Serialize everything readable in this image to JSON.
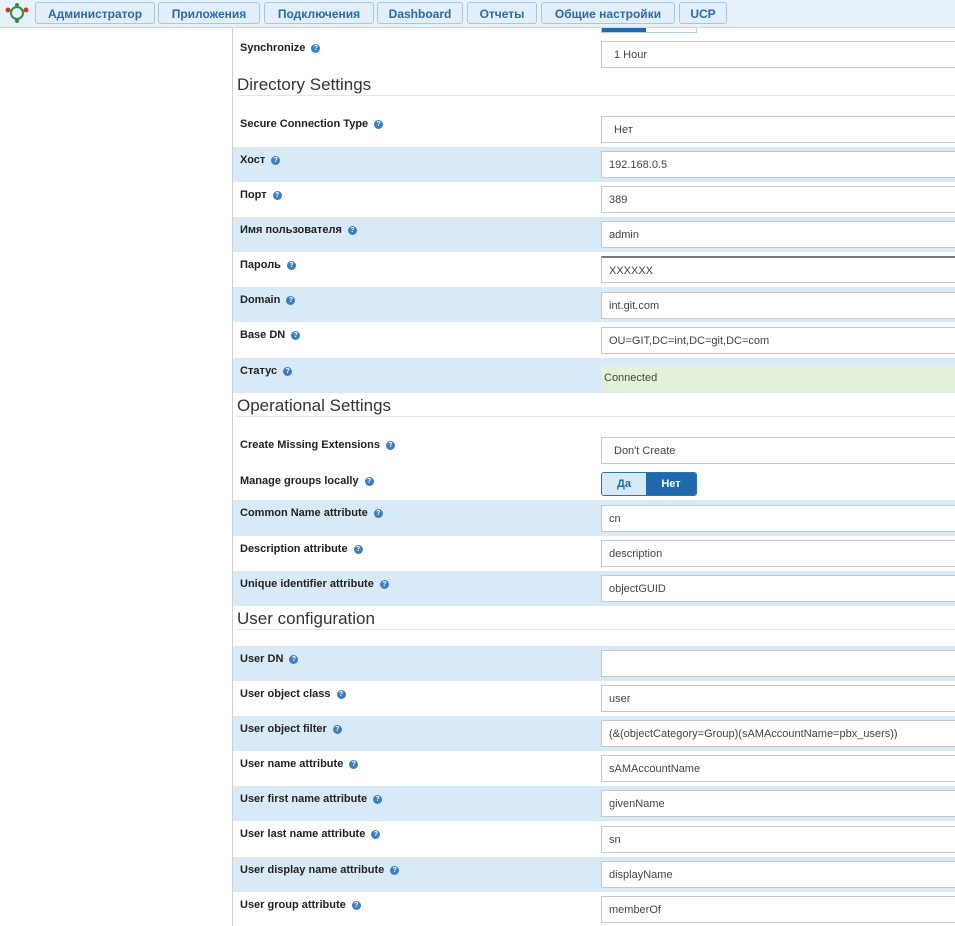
{
  "nav": [
    "Администратор",
    "Приложения",
    "Подключения",
    "Dashboard",
    "Отчеты",
    "Общие настройки",
    "UCP"
  ],
  "help_glyph": "?",
  "sync": {
    "label": "Synchronize",
    "value": "1 Hour"
  },
  "sections": {
    "directory": "Directory Settings",
    "operational": "Operational Settings",
    "user": "User configuration"
  },
  "directory": [
    {
      "label": "Secure Connection Type",
      "value": "Нет"
    },
    {
      "label": "Хост",
      "value": "192.168.0.5"
    },
    {
      "label": "Порт",
      "value": "389"
    },
    {
      "label": "Имя пользователя",
      "value": "admin"
    },
    {
      "label": "Пароль",
      "value": "XXXXXX"
    },
    {
      "label": "Domain",
      "value": "int.git.com"
    },
    {
      "label": "Base DN",
      "value": "OU=GIT,DC=int,DC=git,DC=com"
    },
    {
      "label": "Статус",
      "value": "Connected"
    }
  ],
  "operational": {
    "create_missing": {
      "label": "Create Missing Extensions",
      "value": "Don't Create"
    },
    "manage_groups": {
      "label": "Manage groups locally",
      "yes": "Да",
      "no": "Нет",
      "selected": "Нет"
    },
    "common_name": {
      "label": "Common Name attribute",
      "value": "cn"
    },
    "description": {
      "label": "Description attribute",
      "value": "description"
    },
    "unique_id": {
      "label": "Unique identifier attribute",
      "value": "objectGUID"
    }
  },
  "user": [
    {
      "label": "User DN",
      "value": ""
    },
    {
      "label": "User object class",
      "value": "user"
    },
    {
      "label": "User object filter",
      "value": "(&(objectCategory=Group)(sAMAccountName=pbx_users))"
    },
    {
      "label": "User name attribute",
      "value": "sAMAccountName"
    },
    {
      "label": "User first name attribute",
      "value": "givenName"
    },
    {
      "label": "User last name attribute",
      "value": "sn"
    },
    {
      "label": "User display name attribute",
      "value": "displayName"
    },
    {
      "label": "User group attribute",
      "value": "memberOf"
    }
  ]
}
